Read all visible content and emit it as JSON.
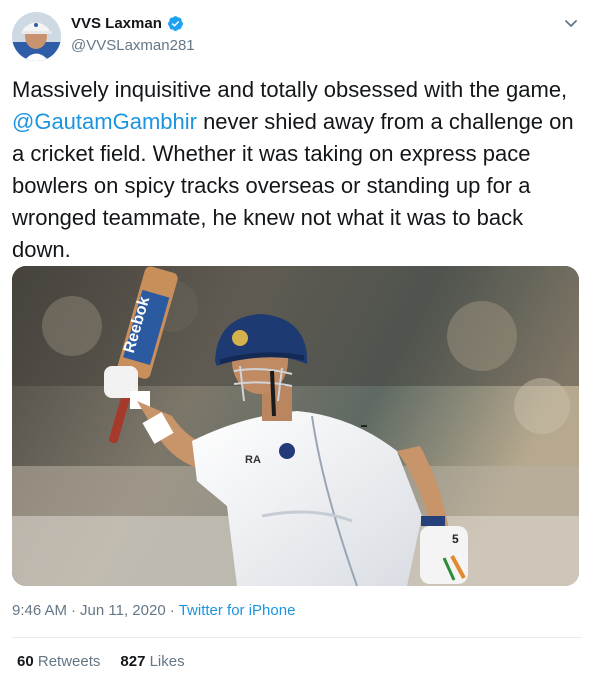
{
  "tweet": {
    "author": {
      "display_name": "VVS Laxman",
      "handle": "@VVSLaxman281",
      "verified": true
    },
    "text_before": "Massively inquisitive and totally obsessed with the game, ",
    "mention": "@GautamGambhir",
    "text_after": " never shied away from a challenge on a cricket field. Whether it was taking on express pace bowlers on spicy tracks overseas or standing up for a wronged teammate, he knew not what it was to back down.",
    "media": {
      "bat_brand": "Reebok",
      "glove_number": "5"
    },
    "time": "9:46 AM",
    "separator": "·",
    "date": "Jun 11, 2020",
    "source": "Twitter for iPhone",
    "retweets": {
      "count": "60",
      "label": "Retweets"
    },
    "likes": {
      "count": "827",
      "label": "Likes"
    }
  },
  "colors": {
    "link": "#1b95e0",
    "muted": "#657786",
    "text": "#14171a",
    "verified": "#1da1f2"
  },
  "icons": {
    "verified": "verified-badge-icon",
    "menu": "chevron-down-icon"
  }
}
